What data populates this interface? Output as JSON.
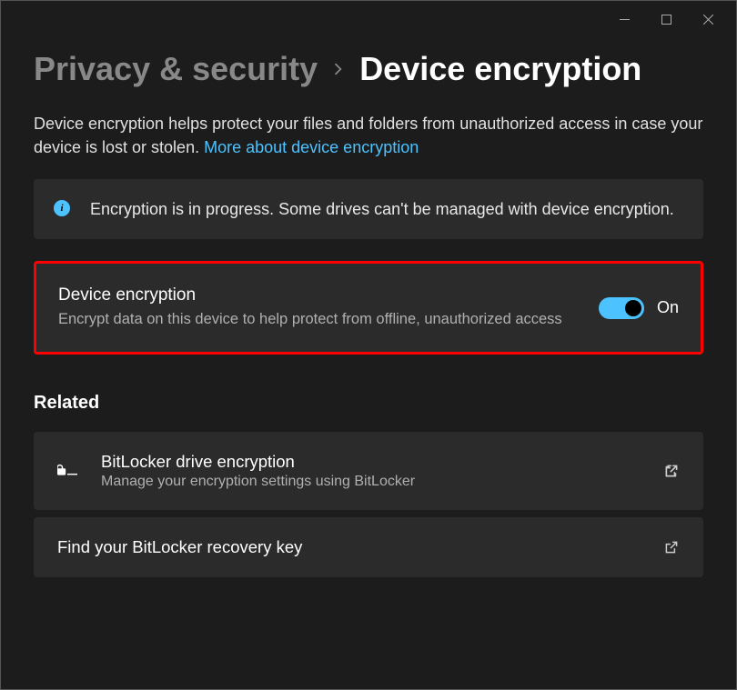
{
  "breadcrumb": {
    "parent": "Privacy & security",
    "current": "Device encryption"
  },
  "intro": {
    "text": "Device encryption helps protect your files and folders from unauthorized access in case your device is lost or stolen. ",
    "link": "More about device encryption"
  },
  "info": {
    "message": "Encryption is in progress. Some drives can't be managed with device encryption."
  },
  "setting": {
    "title": "Device encryption",
    "desc": "Encrypt data on this device to help protect from offline, unauthorized access",
    "state_label": "On"
  },
  "related": {
    "header": "Related",
    "items": [
      {
        "title": "BitLocker drive encryption",
        "desc": "Manage your encryption settings using BitLocker"
      },
      {
        "title": "Find your BitLocker recovery key"
      }
    ]
  }
}
